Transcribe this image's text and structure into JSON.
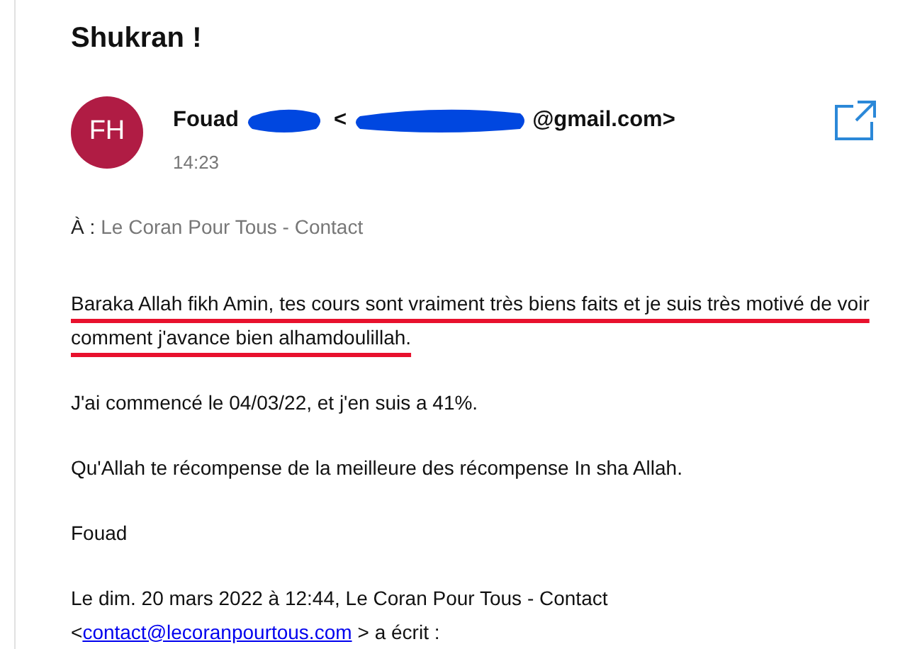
{
  "subject": "Shukran !",
  "sender": {
    "initials": "FH",
    "name": "Fouad",
    "address_open": "<",
    "address_end": "@gmail.com>",
    "redacted": true,
    "time": "14:23"
  },
  "recipient": {
    "label": "À :",
    "name": "Le Coran Pour Tous - Contact"
  },
  "body": [
    {
      "kind": "paragraph",
      "text": "Baraka Allah fikh Amin, tes cours sont vraiment très biens faits et je suis très motivé de voir comment j'avance bien alhamdoulillah.",
      "underlined": true
    },
    {
      "kind": "paragraph",
      "text": "J'ai commencé le 04/03/22, et j'en suis a 41%.",
      "underlined": false
    },
    {
      "kind": "paragraph",
      "text": "Qu'Allah te récompense de la meilleure des récompense In sha Allah.",
      "underlined": false
    },
    {
      "kind": "paragraph",
      "text": "Fouad",
      "underlined": false
    },
    {
      "kind": "quote_header",
      "text": "Le dim. 20 mars 2022 à 12:44, Le Coran Pour Tous - Contact",
      "link_open": "<",
      "link": "contact@lecoranpourtous.com",
      "link_close": "> a écrit :"
    }
  ]
}
